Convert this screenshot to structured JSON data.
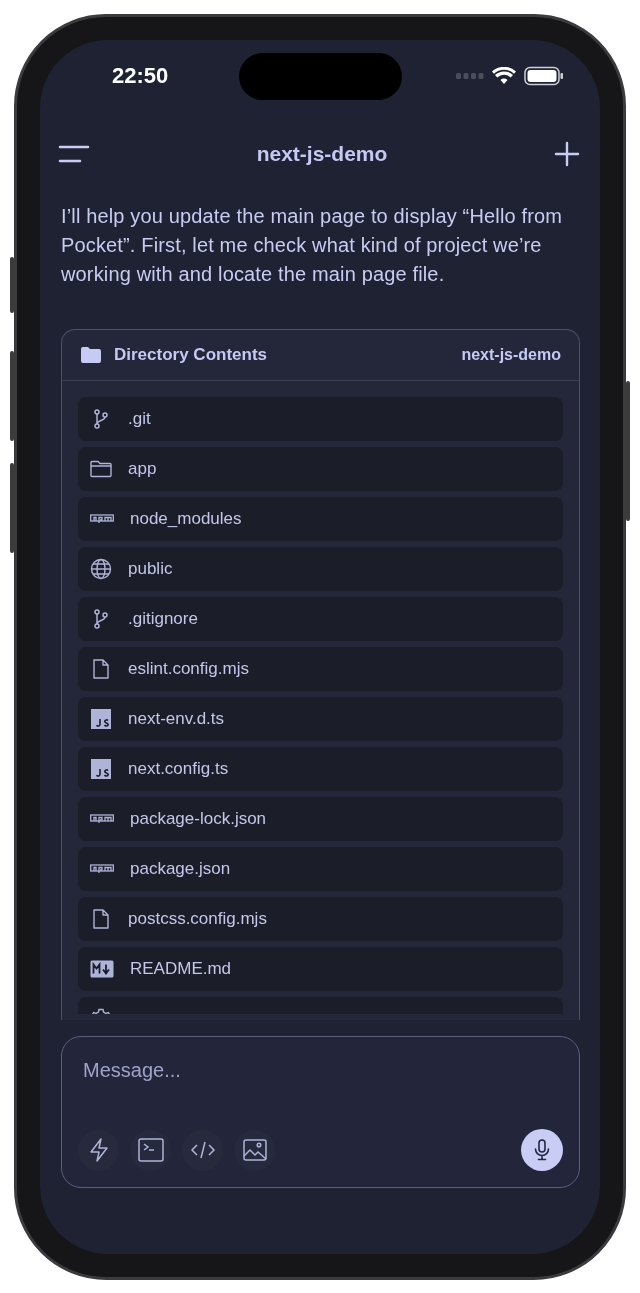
{
  "status_bar": {
    "time": "22:50"
  },
  "header": {
    "title": "next-js-demo"
  },
  "message": "I’ll help you update the main page to display “Hello from Pocket”. First, let me check what kind of project we’re working with and locate the main page file.",
  "directory": {
    "title": "Directory Contents",
    "project": "next-js-demo",
    "entries": [
      {
        "name": ".git",
        "kind": "git"
      },
      {
        "name": "app",
        "kind": "folder"
      },
      {
        "name": "node_modules",
        "kind": "npm"
      },
      {
        "name": "public",
        "kind": "globe"
      },
      {
        "name": ".gitignore",
        "kind": "git"
      },
      {
        "name": "eslint.config.mjs",
        "kind": "file"
      },
      {
        "name": "next-env.d.ts",
        "kind": "js"
      },
      {
        "name": "next.config.ts",
        "kind": "js"
      },
      {
        "name": "package-lock.json",
        "kind": "npm"
      },
      {
        "name": "package.json",
        "kind": "npm"
      },
      {
        "name": "postcss.config.mjs",
        "kind": "file"
      },
      {
        "name": "README.md",
        "kind": "markdown"
      },
      {
        "kind": "gear"
      }
    ]
  },
  "composer": {
    "placeholder": "Message...",
    "tools": [
      {
        "kind": "bolt"
      },
      {
        "kind": "terminal"
      },
      {
        "kind": "code"
      },
      {
        "kind": "image"
      }
    ]
  }
}
